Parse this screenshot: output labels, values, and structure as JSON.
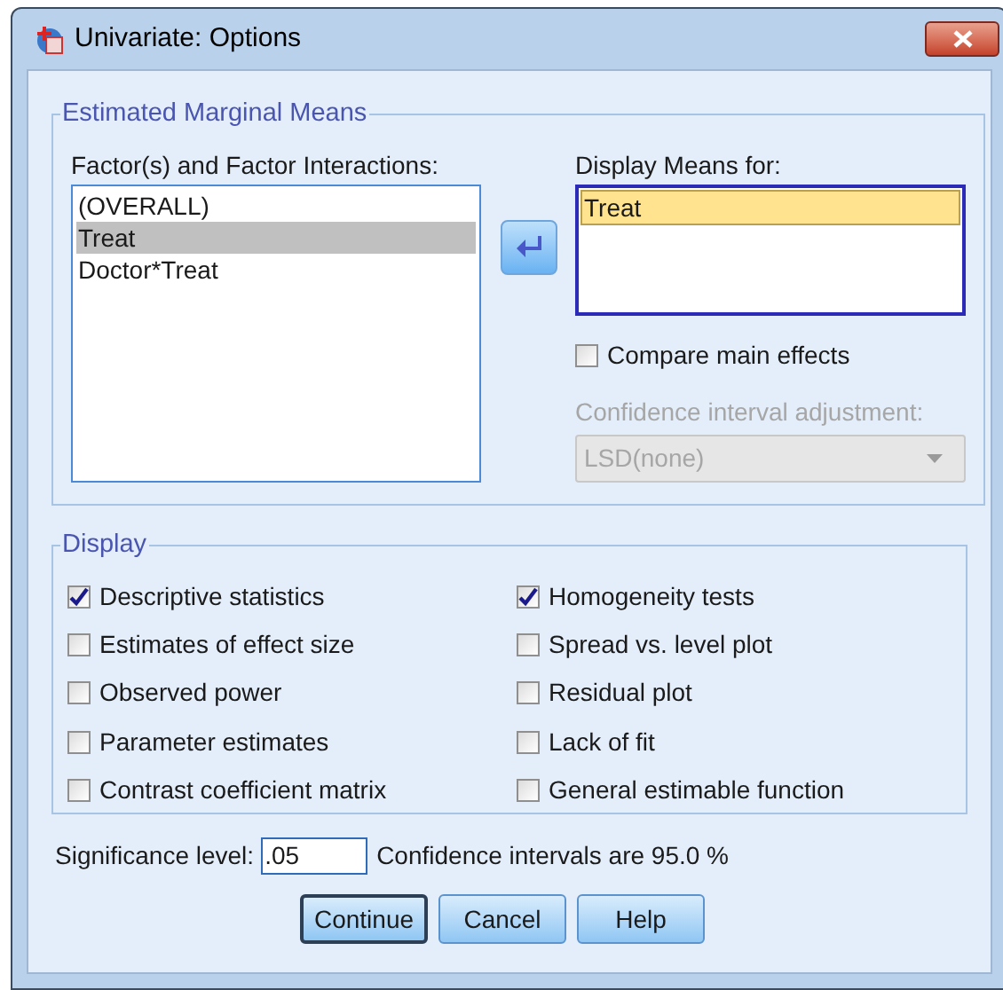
{
  "window": {
    "title": "Univariate: Options"
  },
  "estimated_marginal_means": {
    "title": "Estimated Marginal Means",
    "factors": {
      "label": "Factor(s) and Factor Interactions:",
      "items": [
        {
          "label": "(OVERALL)",
          "selected": false
        },
        {
          "label": "Treat",
          "selected": true
        },
        {
          "label": "Doctor*Treat",
          "selected": false
        }
      ]
    },
    "display_means": {
      "label": "Display Means for:",
      "items": [
        {
          "label": "Treat",
          "selected": true
        }
      ]
    },
    "compare_main_effects": {
      "label": "Compare main effects",
      "checked": false
    },
    "adjustment": {
      "label": "Confidence interval adjustment:",
      "value": "LSD(none)",
      "disabled": true
    }
  },
  "display": {
    "title": "Display",
    "options": [
      {
        "label": "Descriptive statistics",
        "checked": true
      },
      {
        "label": "Homogeneity tests",
        "checked": true
      },
      {
        "label": "Estimates of effect size",
        "checked": false
      },
      {
        "label": "Spread vs. level plot",
        "checked": false
      },
      {
        "label": "Observed power",
        "checked": false
      },
      {
        "label": "Residual plot",
        "checked": false
      },
      {
        "label": "Parameter estimates",
        "checked": false
      },
      {
        "label": "Lack of fit",
        "checked": false
      },
      {
        "label": "Contrast coefficient matrix",
        "checked": false
      },
      {
        "label": "General estimable function",
        "checked": false
      }
    ]
  },
  "significance": {
    "label": "Significance level:",
    "value": ".05",
    "note": "Confidence intervals are 95.0 %"
  },
  "buttons": [
    {
      "label": "Continue",
      "default": true
    },
    {
      "label": "Cancel",
      "default": false
    },
    {
      "label": "Help",
      "default": false
    }
  ]
}
